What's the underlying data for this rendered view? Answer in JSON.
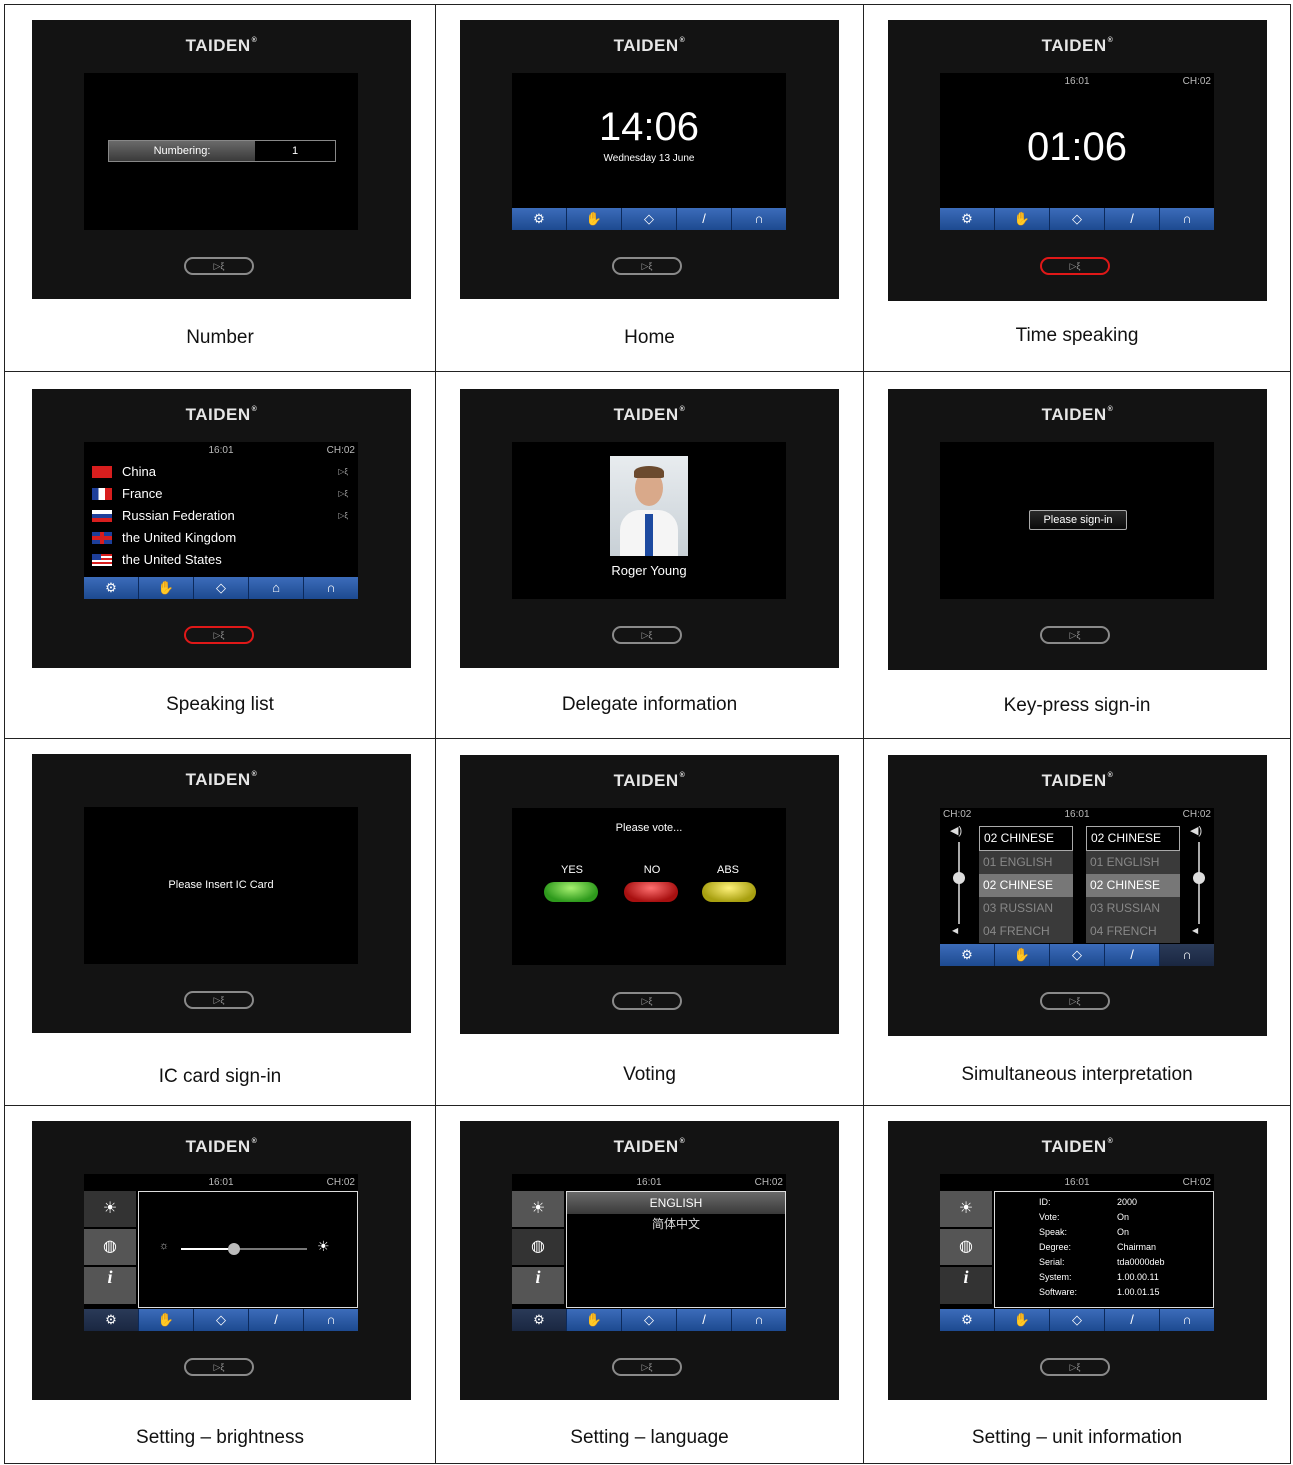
{
  "brand": "TAIDEN",
  "brand_mark": "®",
  "button_glyph": "▷ξ",
  "toolbar_icons": [
    "gear-icon",
    "hand-icon",
    "diamond-icon",
    "microphone-icon",
    "headphone-icon"
  ],
  "panels": [
    {
      "caption": "Number",
      "numbering": {
        "label": "Numbering:",
        "value": "1"
      }
    },
    {
      "caption": "Home",
      "time": "14:06",
      "date": "Wednesday 13 June"
    },
    {
      "caption": "Time speaking",
      "clock": "16:01",
      "channel": "CH:02",
      "timer": "01:06"
    },
    {
      "caption": "Speaking list",
      "clock": "16:01",
      "channel": "CH:02",
      "countries": [
        "China",
        "France",
        "Russian Federation",
        "the United Kingdom",
        "the United States"
      ]
    },
    {
      "caption": "Delegate information",
      "name": "Roger Young"
    },
    {
      "caption": "Key-press sign-in",
      "button": "Please sign-in"
    },
    {
      "caption": "IC card sign-in",
      "message": "Please Insert IC Card"
    },
    {
      "caption": "Voting",
      "prompt": "Please vote...",
      "options": [
        "YES",
        "NO",
        "ABS"
      ]
    },
    {
      "caption": "Simultaneous interpretation",
      "clock": "16:01",
      "channel": "CH:02",
      "channel_left": "CH:02",
      "left_list": [
        "02 CHINESE",
        "01 ENGLISH",
        "02 CHINESE",
        "03 RUSSIAN",
        "04 FRENCH"
      ],
      "right_list": [
        "02 CHINESE",
        "01 ENGLISH",
        "02 CHINESE",
        "03 RUSSIAN",
        "04 FRENCH"
      ]
    },
    {
      "caption": "Setting – brightness",
      "clock": "16:01",
      "channel": "CH:02",
      "brightness": 0.42
    },
    {
      "caption": "Setting – language",
      "clock": "16:01",
      "channel": "CH:02",
      "languages": [
        "ENGLISH",
        "简体中文"
      ]
    },
    {
      "caption": "Setting – unit information",
      "clock": "16:01",
      "channel": "CH:02",
      "info": [
        [
          "ID:",
          "2000"
        ],
        [
          "Vote:",
          "On"
        ],
        [
          "Speak:",
          "On"
        ],
        [
          "Degree:",
          "Chairman"
        ],
        [
          "Serial:",
          "tda0000deb"
        ],
        [
          "System:",
          "1.00.00.11"
        ],
        [
          "Software:",
          "1.00.01.15"
        ]
      ]
    }
  ]
}
